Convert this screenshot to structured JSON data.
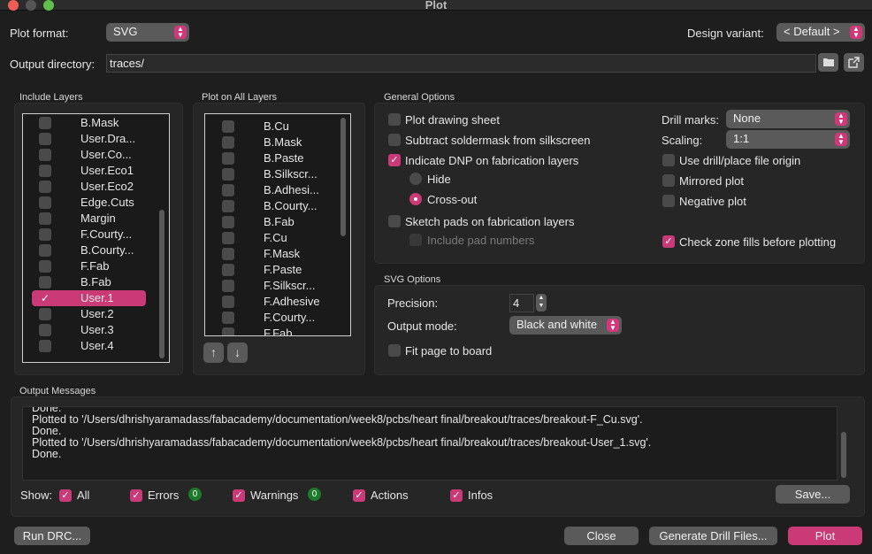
{
  "window": {
    "title": "Plot"
  },
  "plot_format": {
    "label": "Plot format:",
    "value": "SVG"
  },
  "design_variant": {
    "label": "Design variant:",
    "value": "< Default >"
  },
  "output_directory": {
    "label": "Output directory:",
    "value": "traces/"
  },
  "include_layers": {
    "title": "Include Layers",
    "items": [
      {
        "label": "B.Mask",
        "checked": false
      },
      {
        "label": "User.Dra...",
        "checked": false
      },
      {
        "label": "User.Co...",
        "checked": false
      },
      {
        "label": "User.Eco1",
        "checked": false
      },
      {
        "label": "User.Eco2",
        "checked": false
      },
      {
        "label": "Edge.Cuts",
        "checked": false
      },
      {
        "label": "Margin",
        "checked": false
      },
      {
        "label": "F.Courty...",
        "checked": false
      },
      {
        "label": "B.Courty...",
        "checked": false
      },
      {
        "label": "F.Fab",
        "checked": false
      },
      {
        "label": "B.Fab",
        "checked": false
      },
      {
        "label": "User.1",
        "checked": true
      },
      {
        "label": "User.2",
        "checked": false
      },
      {
        "label": "User.3",
        "checked": false
      },
      {
        "label": "User.4",
        "checked": false
      }
    ]
  },
  "plot_all_layers": {
    "title": "Plot on All Layers",
    "items": [
      {
        "label": "B.Cu"
      },
      {
        "label": "B.Mask"
      },
      {
        "label": "B.Paste"
      },
      {
        "label": "B.Silkscr..."
      },
      {
        "label": "B.Adhesi..."
      },
      {
        "label": "B.Courty..."
      },
      {
        "label": "B.Fab"
      },
      {
        "label": "F.Cu"
      },
      {
        "label": "F.Mask"
      },
      {
        "label": "F.Paste"
      },
      {
        "label": "F.Silkscr..."
      },
      {
        "label": "F.Adhesive"
      },
      {
        "label": "F.Courty..."
      },
      {
        "label": "F.Fab"
      }
    ],
    "up_icon": "arrow-up-icon",
    "down_icon": "arrow-down-icon"
  },
  "general_options": {
    "title": "General Options",
    "plot_drawing_sheet": "Plot drawing sheet",
    "subtract_soldermask": "Subtract soldermask from silkscreen",
    "indicate_dnp": "Indicate DNP on fabrication layers",
    "hide": "Hide",
    "cross_out": "Cross-out",
    "sketch_pads": "Sketch pads on fabrication layers",
    "include_pad_numbers": "Include pad numbers",
    "drill_marks_label": "Drill marks:",
    "drill_marks_value": "None",
    "scaling_label": "Scaling:",
    "scaling_value": "1:1",
    "use_drill_origin": "Use drill/place file origin",
    "mirrored_plot": "Mirrored plot",
    "negative_plot": "Negative plot",
    "check_zone_fills": "Check zone fills before plotting"
  },
  "svg_options": {
    "title": "SVG Options",
    "precision_label": "Precision:",
    "precision_value": "4",
    "output_mode_label": "Output mode:",
    "output_mode_value": "Black and white",
    "fit_page": "Fit page to board"
  },
  "output_messages": {
    "title": "Output Messages",
    "lines": [
      "Done.",
      "Plotted to '/Users/dhrishyaramadass/fabacademy/documentation/week8/pcbs/heart final/breakout/traces/breakout-F_Cu.svg'.",
      "Done.",
      "Plotted to '/Users/dhrishyaramadass/fabacademy/documentation/week8/pcbs/heart final/breakout/traces/breakout-User_1.svg'.",
      "Done."
    ],
    "show_label": "Show:",
    "all": "All",
    "errors": "Errors",
    "errors_count": "0",
    "warnings": "Warnings",
    "warnings_count": "0",
    "actions": "Actions",
    "infos": "Infos",
    "save": "Save..."
  },
  "buttons": {
    "run_drc": "Run DRC...",
    "close": "Close",
    "generate_drill": "Generate Drill Files...",
    "plot": "Plot"
  },
  "colors": {
    "accent": "#c93a76",
    "badge": "#1d7a2a"
  }
}
